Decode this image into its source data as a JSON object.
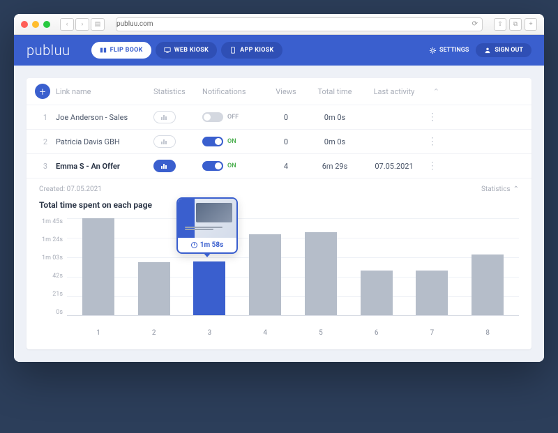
{
  "browser": {
    "url": "publuu.com"
  },
  "header": {
    "logo": "publuu",
    "tabs": {
      "flipbook": "FLIP BOOK",
      "webkiosk": "WEB KIOSK",
      "appkiosk": "APP KIOSK"
    },
    "settings": "SETTINGS",
    "signout": "SIGN OUT"
  },
  "table": {
    "columns": {
      "name": "Link name",
      "stats": "Statistics",
      "notif": "Notifications",
      "views": "Views",
      "total": "Total time",
      "last": "Last activity"
    },
    "rows": [
      {
        "n": "1",
        "name": "Joe Anderson - Sales",
        "stats_active": false,
        "notif_on": false,
        "notif_label": "OFF",
        "views": "0",
        "total": "0m 0s",
        "last": ""
      },
      {
        "n": "2",
        "name": "Patricia Davis GBH",
        "stats_active": false,
        "notif_on": true,
        "notif_label": "ON",
        "views": "0",
        "total": "0m 0s",
        "last": ""
      },
      {
        "n": "3",
        "name": "Emma S - An Offer",
        "stats_active": true,
        "notif_on": true,
        "notif_label": "ON",
        "views": "4",
        "total": "6m 29s",
        "last": "07.05.2021"
      }
    ]
  },
  "stats": {
    "created": "Created: 07.05.2021",
    "label": "Statistics",
    "title": "Total time spent on each page",
    "tooltip_time": "1m 58s"
  },
  "chart_data": {
    "type": "bar",
    "title": "Total time spent on each page",
    "xlabel": "",
    "ylabel": "",
    "categories": [
      "1",
      "2",
      "3",
      "4",
      "5",
      "6",
      "7",
      "8"
    ],
    "values_seconds": [
      104,
      57,
      58,
      87,
      89,
      48,
      48,
      65
    ],
    "highlighted_index": 2,
    "tooltip": {
      "index": 2,
      "label": "1m 58s"
    },
    "y_ticks": [
      "1m 45s",
      "1m 24s",
      "1m 03s",
      "42s",
      "21s",
      "0s"
    ],
    "ylim_seconds": [
      0,
      105
    ]
  }
}
